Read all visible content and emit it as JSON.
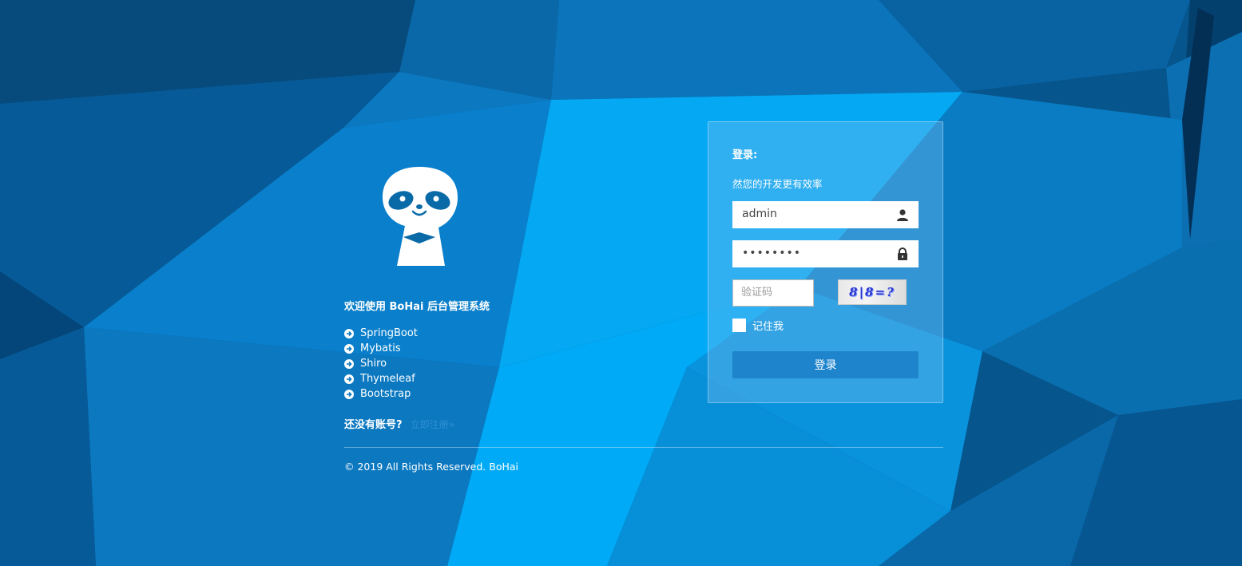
{
  "welcome_title": "欢迎使用 BoHai 后台管理系统",
  "features": [
    "SpringBoot",
    "Mybatis",
    "Shiro",
    "Thymeleaf",
    "Bootstrap"
  ],
  "signup": {
    "question": "还没有账号?",
    "link_label": "立即注册»"
  },
  "footer": "© 2019 All Rights Reserved. BoHai",
  "login": {
    "title": "登录:",
    "subtitle": "然您的开发更有效率",
    "username_value": "admin",
    "password_value": "••••••••",
    "captcha_placeholder": "验证码",
    "captcha_text": "8|8=?",
    "remember_label": "记住我",
    "submit_label": "登录"
  },
  "icons": {
    "feature_bullet": "circle-arrow-right-icon",
    "username": "user-icon",
    "password": "lock-icon",
    "mascot": "panda-mascot-logo"
  },
  "colors": {
    "primary_button": "#1e84cc",
    "link": "#2f8fd3",
    "background_base": "#0a5f9a",
    "background_light": "#00a8f5"
  }
}
